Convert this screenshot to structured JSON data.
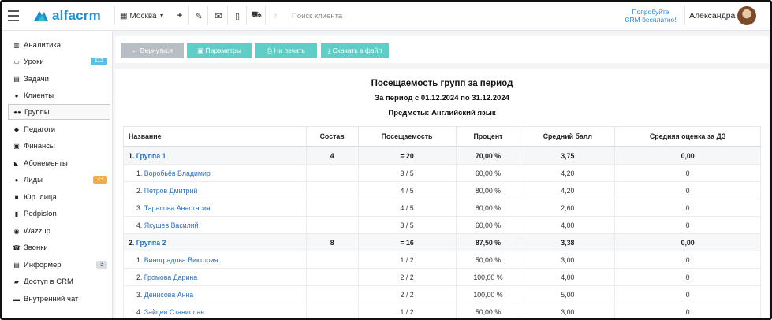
{
  "topbar": {
    "logo_text": "alfacrm",
    "city": "Москва",
    "search_placeholder": "Поиск клиента",
    "promo_line1": "Попробуйте",
    "promo_line2": "CRM бесплатно!",
    "user_name": "Александра"
  },
  "sidebar": {
    "items": [
      {
        "label": "Аналитика",
        "icon": "chart-icon"
      },
      {
        "label": "Уроки",
        "icon": "calendar-icon",
        "badge": "112"
      },
      {
        "label": "Задачи",
        "icon": "tasks-icon"
      },
      {
        "label": "Клиенты",
        "icon": "user-icon"
      },
      {
        "label": "Группы",
        "icon": "users-icon"
      },
      {
        "label": "Педагоги",
        "icon": "graduation-cap-icon"
      },
      {
        "label": "Финансы",
        "icon": "money-icon"
      },
      {
        "label": "Абонементы",
        "icon": "tag-icon"
      },
      {
        "label": "Лиды",
        "icon": "user-plus-icon",
        "badge": "23"
      },
      {
        "label": "Юр. лица",
        "icon": "briefcase-icon"
      },
      {
        "label": "Podpislon",
        "icon": "file-icon"
      },
      {
        "label": "Wazzup",
        "icon": "whatsapp-icon"
      },
      {
        "label": "Звонки",
        "icon": "phone-icon"
      },
      {
        "label": "Информер",
        "icon": "list-icon",
        "badge": "3"
      },
      {
        "label": "Доступ в CRM",
        "icon": "lock-icon"
      },
      {
        "label": "Внутренний чат",
        "icon": "chat-icon"
      }
    ]
  },
  "toolbar": {
    "back_label": "← Вернуться",
    "params_label": "Параметры",
    "print_label": "На печать",
    "download_label": "Скачать в файл"
  },
  "report": {
    "title": "Посещаемость групп за период",
    "period": "За период с 01.12.2024 по 31.12.2024",
    "subjects": "Предметы: Английский язык",
    "columns": [
      "Название",
      "Состав",
      "Посещаемость",
      "Процент",
      "Средний балл",
      "Средняя оценка за ДЗ"
    ],
    "rows": [
      {
        "type": "group",
        "num": "1.",
        "name": "Группа 1",
        "size": "4",
        "attendance": "= 20",
        "percent": "70,00 %",
        "avg": "3,75",
        "hw": "0,00"
      },
      {
        "type": "member",
        "num": "1.",
        "name": "Воробьёв Владимир",
        "size": "",
        "attendance": "3 / 5",
        "percent": "60,00 %",
        "avg": "4,20",
        "hw": "0"
      },
      {
        "type": "member",
        "num": "2.",
        "name": "Петров Дмитрий",
        "size": "",
        "attendance": "4 / 5",
        "percent": "80,00 %",
        "avg": "4,20",
        "hw": "0"
      },
      {
        "type": "member",
        "num": "3.",
        "name": "Тарасова Анастасия",
        "size": "",
        "attendance": "4 / 5",
        "percent": "80,00 %",
        "avg": "2,60",
        "hw": "0"
      },
      {
        "type": "member",
        "num": "4.",
        "name": "Якушев Василий",
        "size": "",
        "attendance": "3 / 5",
        "percent": "60,00 %",
        "avg": "4,00",
        "hw": "0"
      },
      {
        "type": "group",
        "num": "2.",
        "name": "Группа 2",
        "size": "8",
        "attendance": "= 16",
        "percent": "87,50 %",
        "avg": "3,38",
        "hw": "0,00"
      },
      {
        "type": "member",
        "num": "1.",
        "name": "Виноградова Виктория",
        "size": "",
        "attendance": "1 / 2",
        "percent": "50,00 %",
        "avg": "3,00",
        "hw": "0"
      },
      {
        "type": "member",
        "num": "2.",
        "name": "Громова Дарина",
        "size": "",
        "attendance": "2 / 2",
        "percent": "100,00 %",
        "avg": "4,00",
        "hw": "0"
      },
      {
        "type": "member",
        "num": "3.",
        "name": "Денисова Анна",
        "size": "",
        "attendance": "2 / 2",
        "percent": "100,00 %",
        "avg": "5,00",
        "hw": "0"
      },
      {
        "type": "member",
        "num": "4.",
        "name": "Зайцев Станислав",
        "size": "",
        "attendance": "1 / 2",
        "percent": "50,00 %",
        "avg": "3,00",
        "hw": "0"
      }
    ]
  },
  "colors": {
    "accent": "#60cdc6",
    "link": "#2a6fb8",
    "badge_blue": "#5bc0de",
    "badge_orange": "#f0ad4e",
    "badge_grey": "#d9dde2"
  }
}
